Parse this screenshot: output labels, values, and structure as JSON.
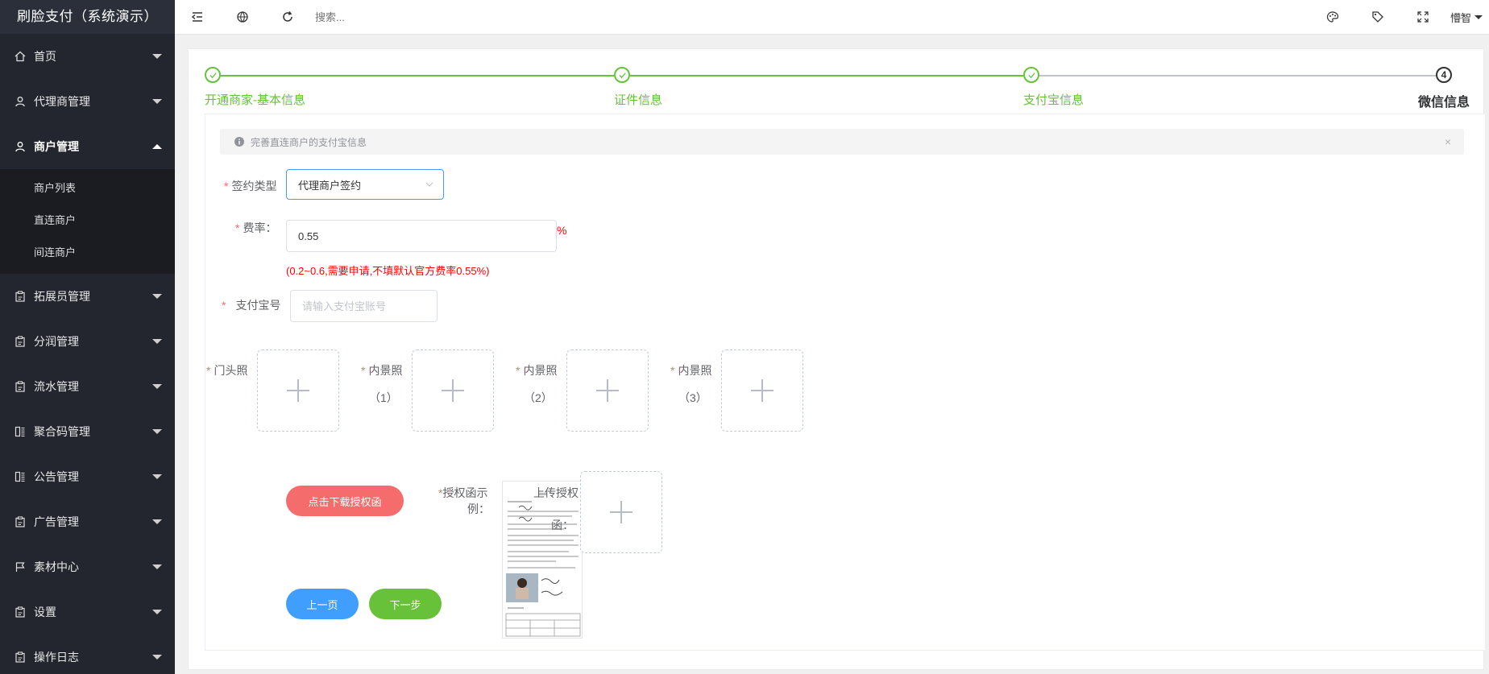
{
  "app": {
    "title": "刷脸支付（系统演示）"
  },
  "sidebar": {
    "items": [
      {
        "label": "首页",
        "icon": "home-icon"
      },
      {
        "label": "代理商管理",
        "icon": "user-icon"
      },
      {
        "label": "商户管理",
        "icon": "user-icon",
        "open": true,
        "children": [
          {
            "label": "商户列表"
          },
          {
            "label": "直连商户"
          },
          {
            "label": "间连商户"
          }
        ]
      },
      {
        "label": "拓展员管理",
        "icon": "clipboard-icon"
      },
      {
        "label": "分润管理",
        "icon": "clipboard-icon"
      },
      {
        "label": "流水管理",
        "icon": "clipboard-icon"
      },
      {
        "label": "聚合码管理",
        "icon": "qrcode-icon"
      },
      {
        "label": "公告管理",
        "icon": "qrcode-icon"
      },
      {
        "label": "广告管理",
        "icon": "clipboard-icon"
      },
      {
        "label": "素材中心",
        "icon": "flag-icon"
      },
      {
        "label": "设置",
        "icon": "clipboard-icon"
      },
      {
        "label": "操作日志",
        "icon": "clipboard-icon"
      }
    ]
  },
  "header": {
    "search_placeholder": "搜索...",
    "user_name": "懵智"
  },
  "steps": [
    {
      "title": "开通商家-基本信息",
      "status": "done"
    },
    {
      "title": "证件信息",
      "status": "done"
    },
    {
      "title": "支付宝信息",
      "status": "done"
    },
    {
      "title": "微信信息",
      "status": "current",
      "number": "4"
    }
  ],
  "alert": {
    "text": "完善直连商户的支付宝信息",
    "close": "×"
  },
  "form": {
    "sign_type": {
      "label": "签约类型",
      "value": "代理商户签约"
    },
    "rate": {
      "label": "费率：",
      "value": "0.55",
      "unit": "%",
      "hint": "(0.2~0.6,需要申请,不填默认官方费率0.55%)"
    },
    "alipay": {
      "label": "支付宝号",
      "placeholder": "请输入支付宝账号"
    },
    "photos": {
      "storefront": "门头照",
      "interior1_label": "内景照",
      "interior1_num": "（1）",
      "interior2_label": "内景照",
      "interior2_num": "（2）",
      "interior3_label": "内景照",
      "interior3_num": "（3）"
    },
    "auth": {
      "download_button": "点击下载授权函",
      "sample_label_1": "授权函示",
      "sample_label_2": "例：",
      "upload_label_1": "上传授权",
      "upload_label_2": "函："
    },
    "buttons": {
      "prev": "上一页",
      "next": "下一步"
    }
  },
  "colors": {
    "sidebar_bg": "#23262e",
    "success": "#67c23a",
    "primary": "#409eff",
    "danger": "#f56c6c",
    "required": "#f56c6c"
  }
}
